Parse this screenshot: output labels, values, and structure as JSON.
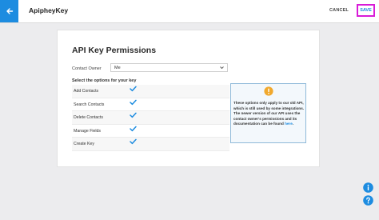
{
  "header": {
    "title": "ApipheyKey",
    "cancel_label": "CANCEL",
    "save_label": "SAVE"
  },
  "card": {
    "heading": "API Key Permissions",
    "contact_owner_label": "Contact Owner",
    "contact_owner_value": "Me",
    "options_title": "Select the options for your key",
    "permissions": [
      {
        "label": "Add Contacts",
        "checked": true
      },
      {
        "label": "Search Contacts",
        "checked": true
      },
      {
        "label": "Delete Contacts",
        "checked": true
      },
      {
        "label": "Manage Fields",
        "checked": true
      },
      {
        "label": "Create Key",
        "checked": true
      }
    ],
    "info_text": "These options only apply to our old API, which is still used by some integrations. The newer version of our API uses the contact owner's permissions and its documentation can be found",
    "info_link": "here",
    "info_end": "."
  },
  "colors": {
    "accent": "#1d8ce0",
    "warning": "#f1a92e",
    "save_highlight": "#d81bd8"
  },
  "icons": [
    "arrow-left-icon",
    "chevron-down-icon",
    "checkmark-icon",
    "exclamation-icon",
    "info-icon",
    "question-icon"
  ]
}
